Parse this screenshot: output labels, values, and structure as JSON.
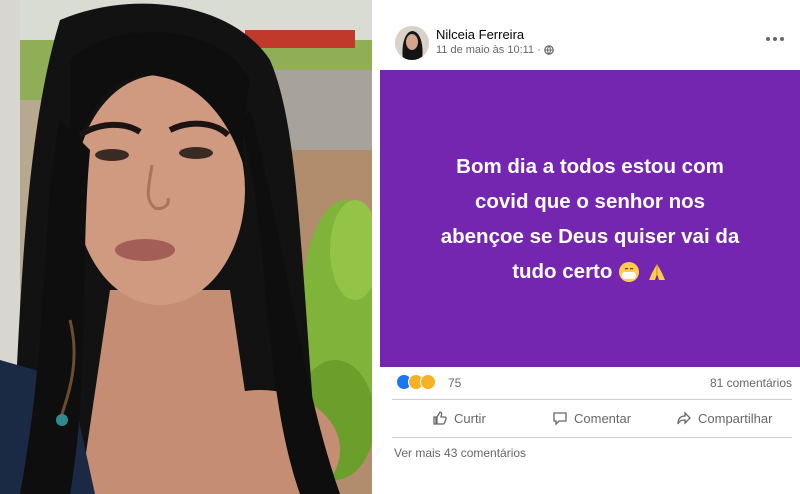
{
  "post": {
    "author": "Nilceia Ferreira",
    "timestamp": "11 de maio às 10:11 ·",
    "privacy_icon": "globe-icon",
    "more_icon": "more-options-icon",
    "status_text_lines": [
      "Bom dia a todos estou com",
      "covid que o senhor nos",
      "abençoe se Deus quiser vai da",
      "tudo certo"
    ],
    "status_emojis": [
      "face-with-mask",
      "folded-hands"
    ],
    "background_color": "#7526b0"
  },
  "reactions": {
    "icons": [
      "like-icon",
      "sad-icon",
      "care-icon"
    ],
    "count": "75",
    "comments": "81 comentários"
  },
  "actions": {
    "like": "Curtir",
    "comment": "Comentar",
    "share": "Compartilhar"
  },
  "footer": {
    "view_more": "Ver mais 43 comentários"
  }
}
